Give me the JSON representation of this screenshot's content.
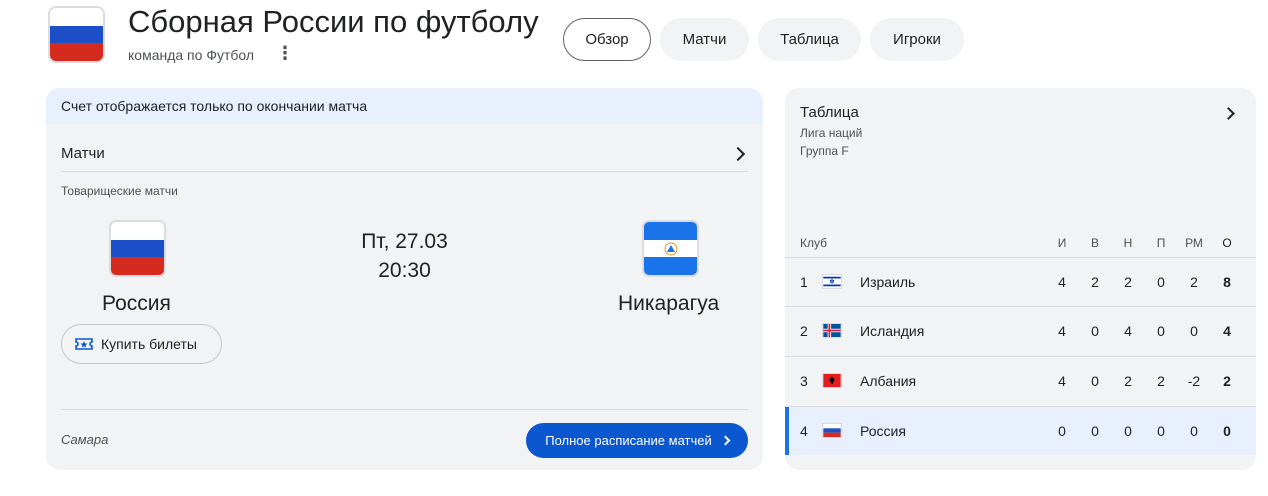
{
  "header": {
    "title": "Сборная России по футболу",
    "subtitle": "команда по Футбол"
  },
  "tabs": [
    {
      "label": "Обзор",
      "active": true
    },
    {
      "label": "Матчи",
      "active": false
    },
    {
      "label": "Таблица",
      "active": false
    },
    {
      "label": "Игроки",
      "active": false
    }
  ],
  "match_card": {
    "notice": "Счет отображается только по окончании матча",
    "matches_label": "Матчи",
    "competition": "Товарищеские матчи",
    "home_team": "Россия",
    "away_team": "Никарагуа",
    "date": "Пт, 27.03",
    "time": "20:30",
    "tickets_label": "Купить билеты",
    "venue": "Самара",
    "schedule_label": "Полное расписание матчей"
  },
  "standings": {
    "title": "Таблица",
    "league": "Лига наций",
    "group": "Группа F",
    "columns": {
      "club": "Клуб",
      "played": "И",
      "won": "В",
      "drawn": "Н",
      "lost": "П",
      "goal_diff": "РМ",
      "points": "О"
    },
    "rows": [
      {
        "pos": "1",
        "club": "Израиль",
        "played": "4",
        "won": "2",
        "drawn": "2",
        "lost": "0",
        "goal_diff": "2",
        "points": "8",
        "flag": "israel-flag-icon"
      },
      {
        "pos": "2",
        "club": "Исландия",
        "played": "4",
        "won": "0",
        "drawn": "4",
        "lost": "0",
        "goal_diff": "0",
        "points": "4",
        "flag": "iceland-flag-icon"
      },
      {
        "pos": "3",
        "club": "Албания",
        "played": "4",
        "won": "0",
        "drawn": "2",
        "lost": "2",
        "goal_diff": "-2",
        "points": "2",
        "flag": "albania-flag-icon"
      },
      {
        "pos": "4",
        "club": "Россия",
        "played": "0",
        "won": "0",
        "drawn": "0",
        "lost": "0",
        "goal_diff": "0",
        "points": "0",
        "flag": "russia-flag-icon",
        "highlighted": true
      }
    ]
  },
  "colors": {
    "accent": "#0b57d0",
    "highlight_bg": "#e8f0fe",
    "card_bg": "#f1f3f4"
  }
}
